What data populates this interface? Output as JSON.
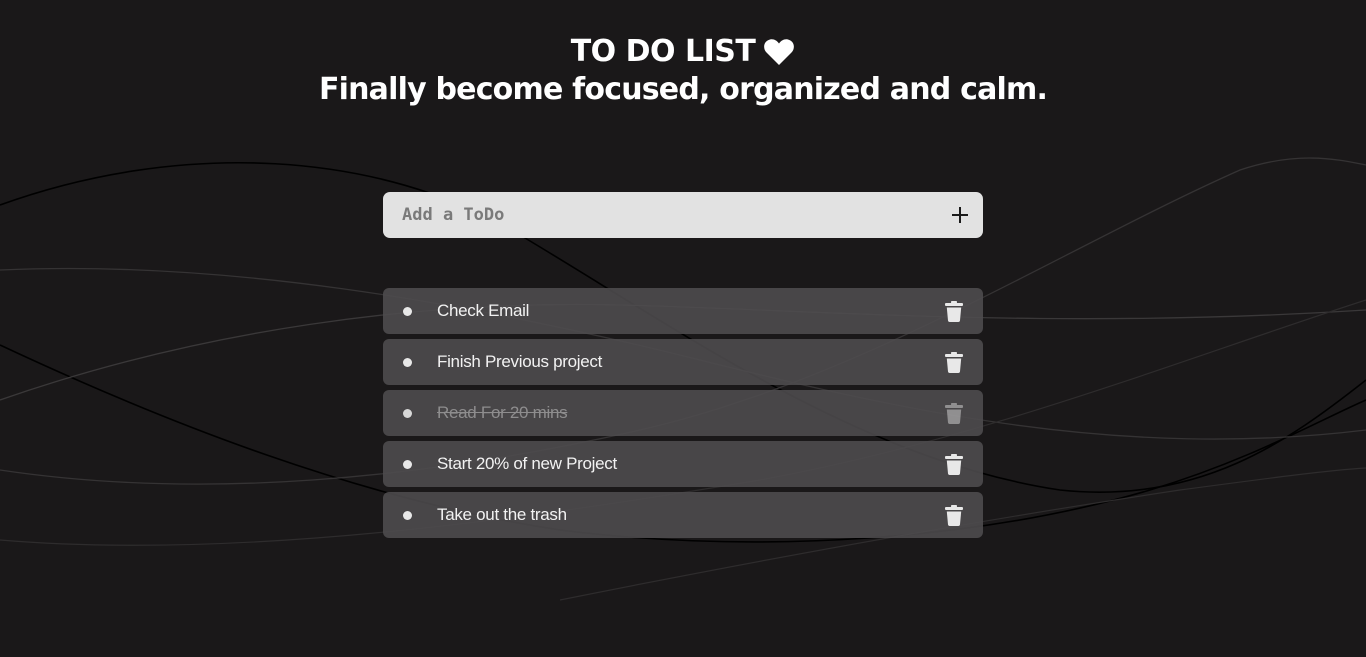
{
  "header": {
    "title": "TO DO LIST",
    "subtitle": "Finally become focused, organized and calm."
  },
  "add_todo": {
    "placeholder": "Add a ToDo",
    "value": ""
  },
  "todos": [
    {
      "text": "Check Email",
      "done": false
    },
    {
      "text": "Finish Previous project",
      "done": false
    },
    {
      "text": "Read For 20 mins",
      "done": true
    },
    {
      "text": "Start 20% of new Project",
      "done": false
    },
    {
      "text": "Take out the trash",
      "done": false
    }
  ],
  "icons": {
    "title": "heart-icon",
    "add": "plus-icon",
    "delete": "trash-icon",
    "item": "bullet-icon"
  },
  "colors": {
    "background": "#1a1819",
    "input_background": "#e2e2e2",
    "item_background": "#4e4c4e",
    "text": "#ffffff",
    "done_text": "#8e8d8e"
  }
}
